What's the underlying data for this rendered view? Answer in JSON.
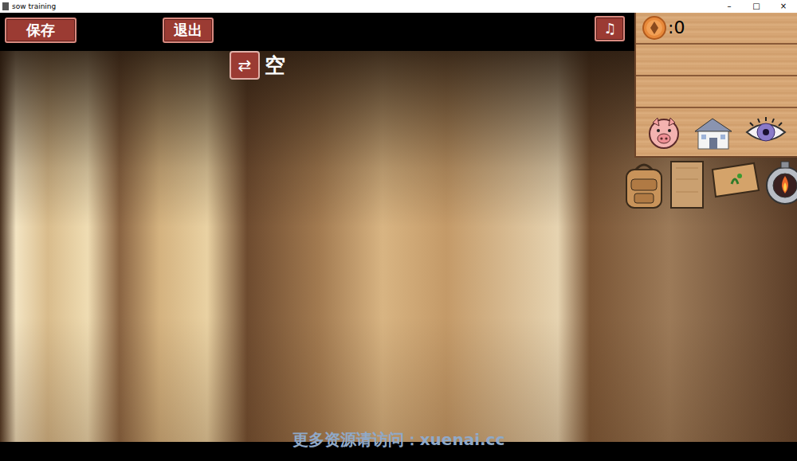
{
  "window": {
    "title": "sow training",
    "controls": [
      "–",
      "□",
      "×"
    ]
  },
  "toolbar": {
    "save": "保存",
    "exit": "退出",
    "music": "♫"
  },
  "slot": {
    "swap": "⇄",
    "label": "空"
  },
  "wallet": {
    "amount": ":0"
  },
  "watermark": "更多资源请访问：xuenai.cc"
}
